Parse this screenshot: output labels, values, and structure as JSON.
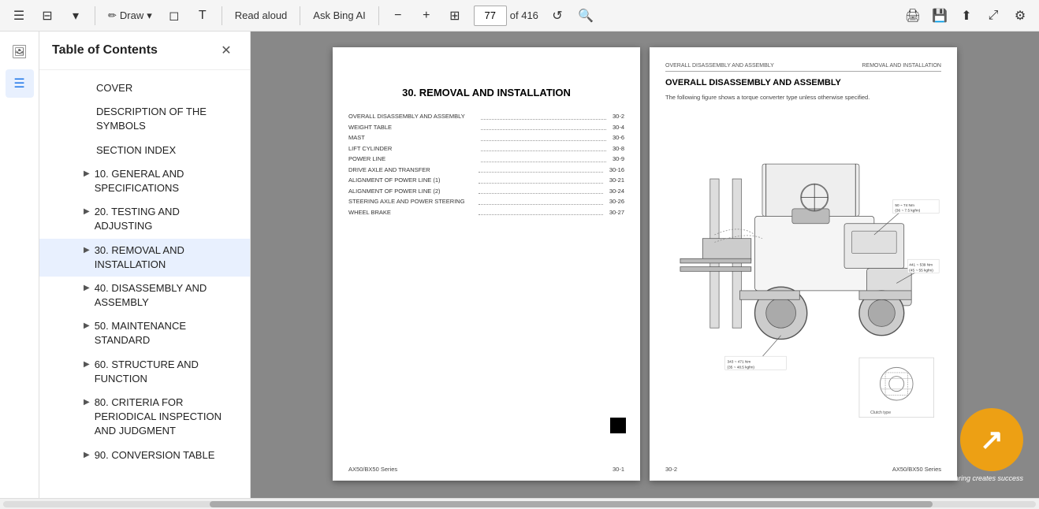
{
  "toolbar": {
    "menu_icon": "☰",
    "bookmark_icon": "⊟",
    "draw_label": "Draw",
    "draw_icon": "▾",
    "erase_icon": "◻",
    "text_icon": "T",
    "read_aloud_label": "Read aloud",
    "ask_bing_label": "Ask Bing AI",
    "zoom_minus": "−",
    "zoom_plus": "+",
    "fit_icon": "⊞",
    "page_current": "77",
    "page_total": "of 416",
    "rotate_icon": "↺",
    "print_icon": "🖨",
    "save_icon": "💾",
    "share_icon": "⬆",
    "fullscreen_icon": "⤢",
    "settings_icon": "⚙"
  },
  "sidebar": {
    "title": "Table of Contents",
    "close_icon": "✕",
    "icon1": "🖼",
    "icon2": "☰",
    "items": [
      {
        "label": "COVER",
        "arrow": false,
        "indent": false
      },
      {
        "label": "DESCRIPTION OF THE SYMBOLS",
        "arrow": false,
        "indent": false
      },
      {
        "label": "SECTION INDEX",
        "arrow": false,
        "indent": false
      },
      {
        "label": "10. GENERAL AND SPECIFICATIONS",
        "arrow": true,
        "indent": false
      },
      {
        "label": "20. TESTING AND ADJUSTING",
        "arrow": true,
        "indent": false
      },
      {
        "label": "30. REMOVAL AND INSTALLATION",
        "arrow": true,
        "indent": false,
        "active": true
      },
      {
        "label": "40. DISASSEMBLY AND ASSEMBLY",
        "arrow": true,
        "indent": false
      },
      {
        "label": "50. MAINTENANCE STANDARD",
        "arrow": true,
        "indent": false
      },
      {
        "label": "60. STRUCTURE AND FUNCTION",
        "arrow": true,
        "indent": false
      },
      {
        "label": "80. CRITERIA FOR PERIODICAL INSPECTION AND JUDGMENT",
        "arrow": true,
        "indent": false
      },
      {
        "label": "90. CONVERSION TABLE",
        "arrow": true,
        "indent": false
      }
    ]
  },
  "page1": {
    "title": "30. REMOVAL AND INSTALLATION",
    "toc_entries": [
      {
        "label": "OVERALL DISASSEMBLY AND ASSEMBLY",
        "page": "30-2"
      },
      {
        "label": "WEIGHT TABLE",
        "page": "30-4"
      },
      {
        "label": "MAST",
        "page": "30-6"
      },
      {
        "label": "LIFT CYLINDER",
        "page": "30-8"
      },
      {
        "label": "POWER LINE",
        "page": "30-9"
      },
      {
        "label": "DRIVE AXLE AND TRANSFER",
        "page": "30-16"
      },
      {
        "label": "ALIGNMENT OF POWER LINE (1)",
        "page": "30-21"
      },
      {
        "label": "ALIGNMENT OF POWER LINE (2)",
        "page": "30-24"
      },
      {
        "label": "STEERING AXLE AND POWER STEERING",
        "page": "30-26"
      },
      {
        "label": "WHEEL BRAKE",
        "page": "30-27"
      }
    ],
    "footer_left": "AX50/BX50 Series",
    "footer_right": "30-1"
  },
  "page2": {
    "header_left": "OVERALL DISASSEMBLY AND ASSEMBLY",
    "header_right": "REMOVAL AND INSTALLATION",
    "section_title": "OVERALL DISASSEMBLY AND ASSEMBLY",
    "subtitle": "The following figure shows a torque converter type unless otherwise specified.",
    "torque_labels": [
      "50 ~ 74 Nm\n(36 ~ 7.5 kgfm)",
      "441 ~ 539 Nm\n(45 ~ 55 kgfm)",
      "343 ~ 471 Nm\n(35 ~ 48.5 kgfm)",
      "Clutch type"
    ],
    "footer_left": "30-2",
    "footer_right": "AX50/BX50 Series"
  },
  "watermark": {
    "text": "Sharing creates success"
  },
  "bottom_scrollbar": {
    "label": ""
  }
}
